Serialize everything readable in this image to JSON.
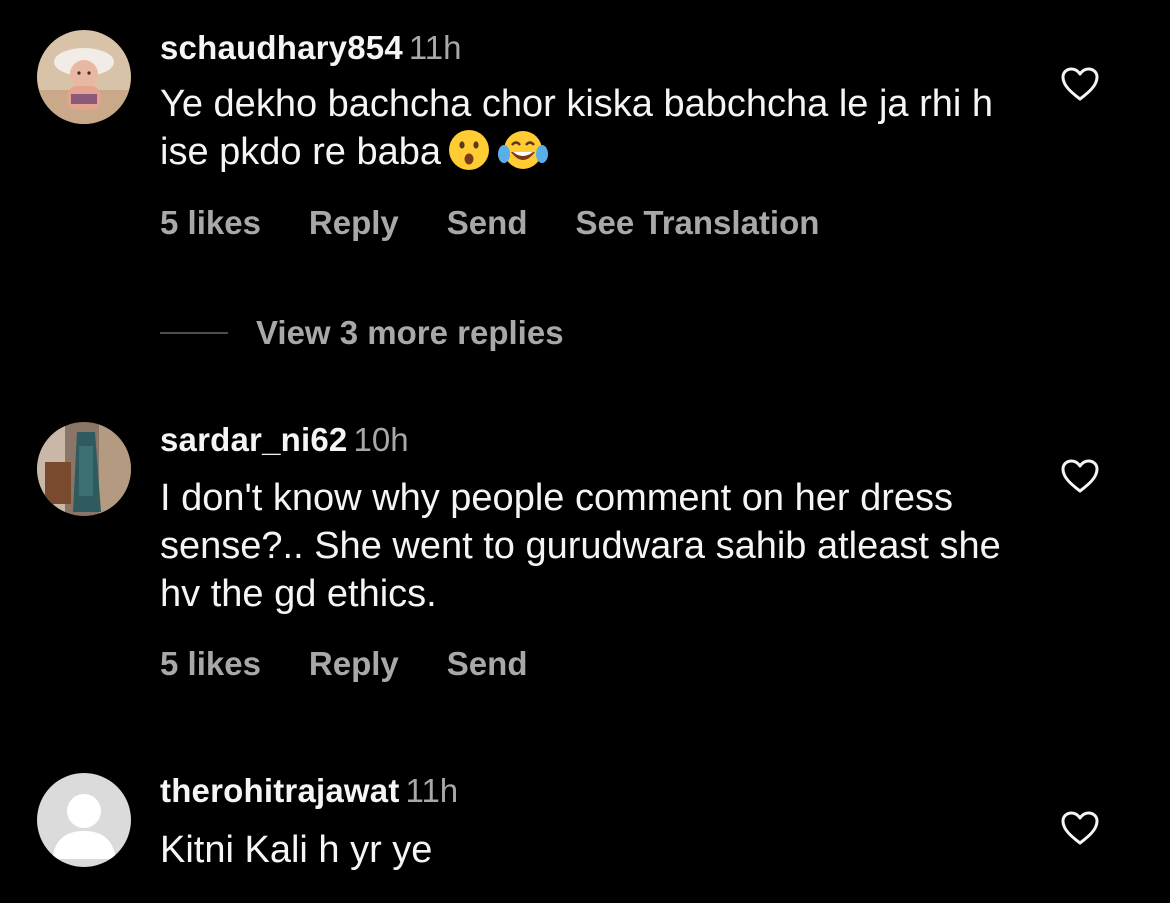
{
  "comments": [
    {
      "username": "schaudhary854",
      "time": "11h",
      "text": "Ye dekho bachcha chor kiska babchcha le ja rhi h ise pkdo re baba",
      "emojis": [
        "astonished-face-emoji",
        "tears-of-joy-emoji"
      ],
      "likes": "5 likes",
      "reply": "Reply",
      "send": "Send",
      "translation": "See Translation"
    },
    {
      "username": "sardar_ni62",
      "time": "10h",
      "text": "I don't know why people comment on her dress sense?.. She went to gurudwara sahib atleast she hv the gd ethics.",
      "likes": "5 likes",
      "reply": "Reply",
      "send": "Send"
    },
    {
      "username": "therohitrajawat",
      "time": "11h",
      "text": "Kitni Kali h yr ye"
    }
  ],
  "view_more_replies": "View 3 more replies",
  "icons": {
    "like": "heart-outline-icon",
    "default_avatar": "default-avatar-icon"
  },
  "colors": {
    "background": "#000000",
    "primary_text": "#f5f5f5",
    "secondary_text": "#a8a8a8"
  }
}
